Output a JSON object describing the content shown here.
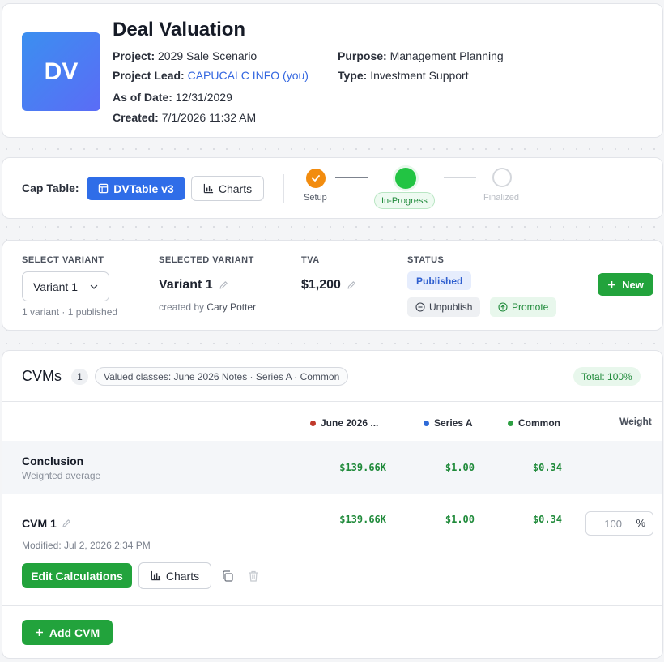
{
  "header": {
    "logo_initials": "DV",
    "title": "Deal Valuation",
    "project_label": "Project:",
    "project_value": "2029 Sale Scenario",
    "lead_label": "Project Lead:",
    "lead_value": "CAPUCALC INFO (you)",
    "asof_label": "As of Date:",
    "asof_value": "12/31/2029",
    "created_label": "Created:",
    "created_value": "7/1/2026 11:32 AM",
    "purpose_label": "Purpose:",
    "purpose_value": "Management Planning",
    "type_label": "Type:",
    "type_value": "Investment Support",
    "logo_gradient": [
      "#3b8ff0",
      "#5b6cf6"
    ]
  },
  "cap_table": {
    "label": "Cap Table:",
    "table_button": "DVTable v3",
    "charts_button": "Charts",
    "steps": [
      {
        "label": "Setup",
        "state": "done",
        "color": "#f28c0f"
      },
      {
        "label": "In-Progress",
        "state": "current",
        "color": "#22c443"
      },
      {
        "label": "Finalized",
        "state": "pending",
        "color": "#d4d7dc"
      }
    ]
  },
  "variant": {
    "select_header": "SELECT VARIANT",
    "select_value": "Variant 1",
    "select_sub": "1 variant · 1 published",
    "selected_header": "SELECTED VARIANT",
    "selected_value": "Variant 1",
    "created_by_prefix": "created by",
    "created_by_name": "Cary Potter",
    "tva_header": "TVA",
    "tva_value": "$1,200",
    "status_header": "STATUS",
    "status_value": "Published",
    "unpublish_label": "Unpublish",
    "promote_label": "Promote",
    "new_label": "New"
  },
  "cvms": {
    "title": "CVMs",
    "count": "1",
    "valued_classes": "Valued classes: June 2026 Notes · Series A · Common",
    "total": "Total: 100%",
    "columns": [
      {
        "label": "June 2026 ...",
        "color": "#c0392b"
      },
      {
        "label": "Series A",
        "color": "#2f6bd8"
      },
      {
        "label": "Common",
        "color": "#2ea043"
      }
    ],
    "weight_header": "Weight",
    "conclusion": {
      "title": "Conclusion",
      "subtitle": "Weighted average",
      "values": [
        "$139.66K",
        "$1.00",
        "$0.34"
      ],
      "weight": "–"
    },
    "rows": [
      {
        "title": "CVM 1",
        "modified": "Modified: Jul 2, 2026 2:34 PM",
        "values": [
          "$139.66K",
          "$1.00",
          "$0.34"
        ],
        "weight": "100",
        "weight_unit": "%",
        "edit_label": "Edit Calculations",
        "charts_label": "Charts"
      }
    ],
    "add_label": "Add CVM"
  }
}
